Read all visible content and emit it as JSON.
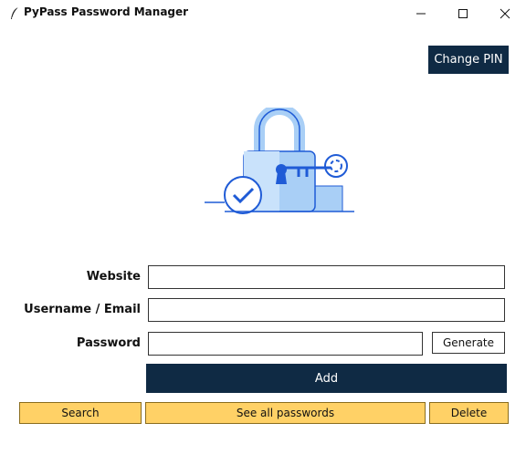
{
  "window": {
    "title": "PyPass Password Manager",
    "controls": [
      "minimize-icon",
      "maximize-icon",
      "close-icon"
    ]
  },
  "header": {
    "change_pin_label": "Change PIN"
  },
  "illustration": {
    "icon": "padlock-key-check-illustration"
  },
  "form": {
    "website_label": "Website",
    "website_value": "",
    "username_label": "Username / Email",
    "username_value": "",
    "password_label": "Password",
    "password_value": "",
    "generate_label": "Generate",
    "add_label": "Add"
  },
  "actions": {
    "search_label": "Search",
    "see_all_label": "See all passwords",
    "delete_label": "Delete"
  },
  "colors": {
    "primary": "#0f2a44",
    "secondary": "#ffd166",
    "illustration_blue": "#1f5bd6",
    "illustration_light": "#a9cff6"
  }
}
